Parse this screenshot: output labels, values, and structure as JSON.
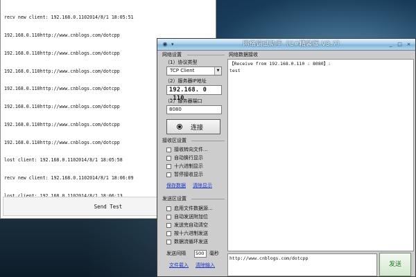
{
  "console": {
    "log_lines": [
      "recv new client: 192.168.0.1102014/8/1 18:05:51",
      "192.168.0.110http://www.cnblogs.com/dotcpp",
      "192.168.0.110http://www.cnblogs.com/dotcpp",
      "192.168.0.110http://www.cnblogs.com/dotcpp",
      "192.168.0.110http://www.cnblogs.com/dotcpp",
      "192.168.0.110http://www.cnblogs.com/dotcpp",
      "192.168.0.110http://www.cnblogs.com/dotcpp",
      "192.168.0.110http://www.cnblogs.com/dotcpp",
      "lost client: 192.168.0.1102014/8/1 18:05:58",
      "recv new client: 192.168.0.1102014/8/1 18:06:09",
      "lost client: 192.168.0.1102014/8/1 18:06:13"
    ],
    "send_test_label": "Send Test"
  },
  "netwin": {
    "title": "网络调试助手（C#精装版 V3.7）",
    "window_buttons": [
      "_",
      "□",
      "×"
    ],
    "settings": {
      "group_label": "网络设置",
      "protocol_label": "（1）协议类型",
      "protocol_value": "TCP Client",
      "ip_label": "（2）服务器IP地址",
      "ip_value": "192.168. 0 .110",
      "port_label": "（2）服务器端口",
      "port_value": "8080",
      "connect_label": "连接"
    },
    "recv_settings": {
      "group_label": "接收区设置",
      "options": [
        "接收转向文件...",
        "自动换行显示",
        "十六进制显示",
        "暂停接收显示"
      ],
      "save_link": "保存数据",
      "clear_link": "清除显示"
    },
    "send_settings": {
      "group_label": "发送区设置",
      "options": [
        "启用文件数据源...",
        "自动发送附加位",
        "发送完自动清空",
        "按十六进制发送",
        "数据流循环发送"
      ],
      "interval_label": "发送间隔",
      "interval_value": "500",
      "interval_unit": "毫秒",
      "file_load_link": "文件载入",
      "clear_input_link": "清除输入"
    },
    "recv_area": {
      "label": "网络数据接收",
      "lines": [
        "【Receive from 192.168.0.110 : 8080】:",
        "test"
      ]
    },
    "send_area": {
      "value": "http://www.cnblogs.com/dotcpp",
      "send_label": "发送"
    }
  }
}
